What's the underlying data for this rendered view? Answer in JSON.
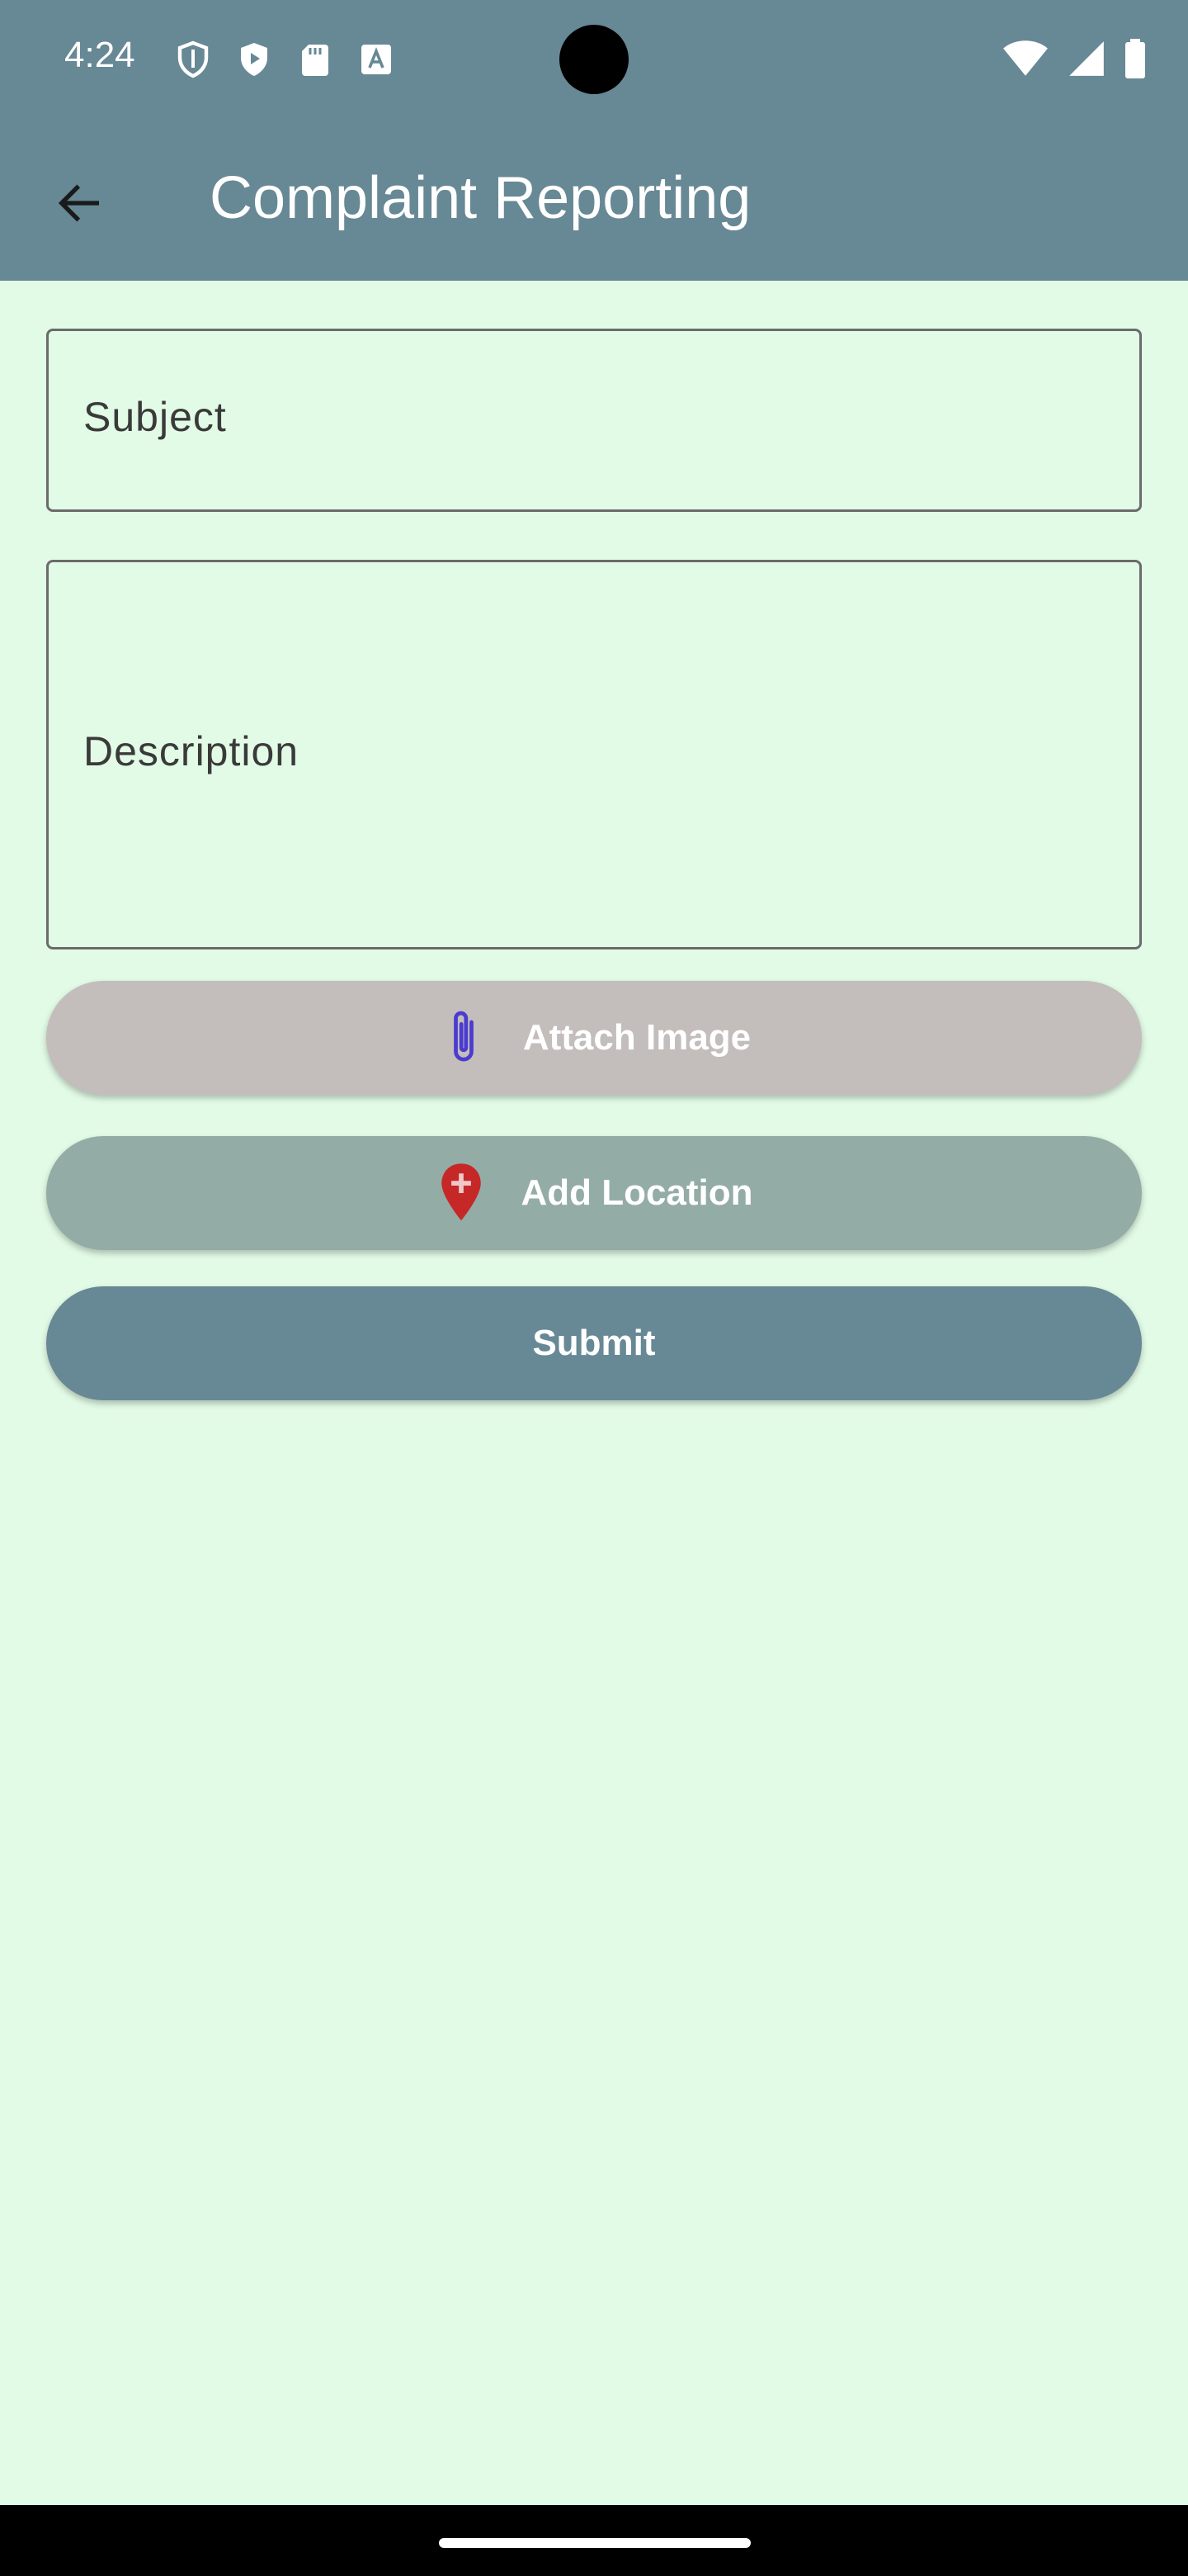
{
  "status_bar": {
    "time": "4:24",
    "left_icons": [
      "shield-icon",
      "play-protect-icon",
      "sd-card-icon",
      "font-icon"
    ],
    "right_icons": [
      "wifi-icon",
      "signal-icon",
      "battery-icon"
    ]
  },
  "app_bar": {
    "title": "Complaint Reporting",
    "back_icon": "arrow-left-icon"
  },
  "form": {
    "subject_label": "Subject",
    "description_label": "Description",
    "attach_label": "Attach Image",
    "location_label": "Add Location",
    "submit_label": "Submit"
  },
  "colors": {
    "app_bar": "#678895",
    "background": "#e2fbe6",
    "attach_button": "#c3bebb",
    "location_button": "#94aca6",
    "submit_button": "#678895",
    "paperclip_icon": "#4b3bd0",
    "location_icon": "#c62828"
  }
}
